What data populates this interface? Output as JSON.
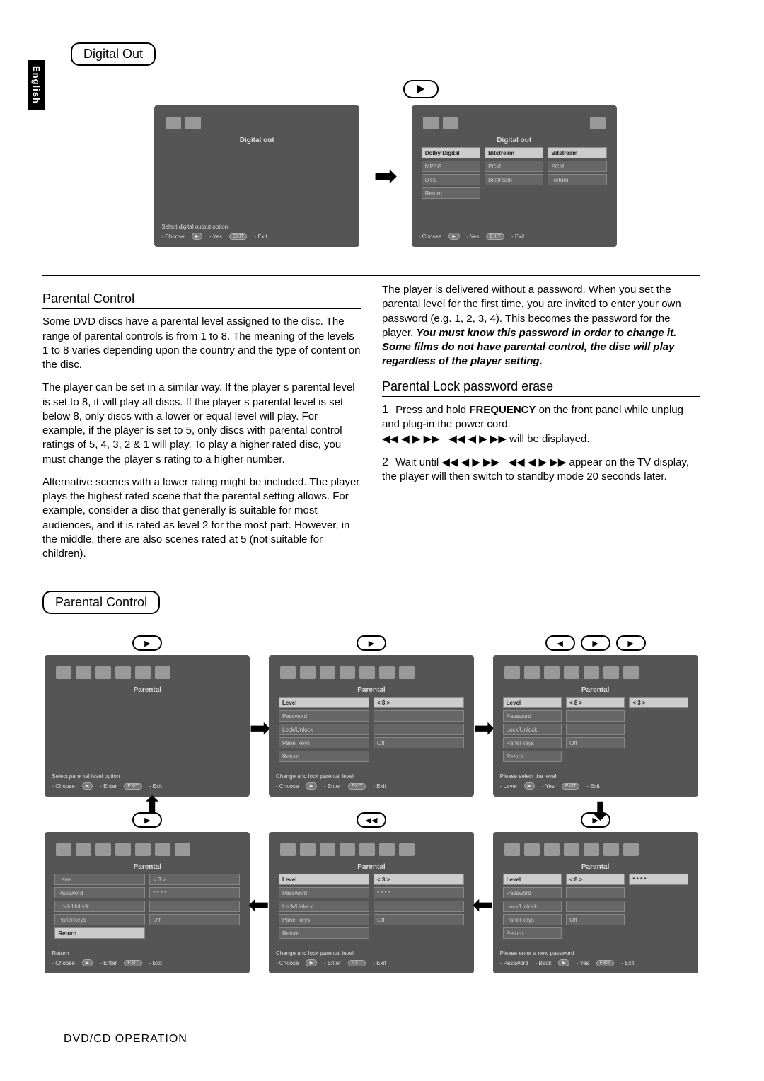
{
  "lang_tab": "English",
  "digital_out": {
    "label": "Digital Out",
    "screen1": {
      "title": "Digital out",
      "bottom": "Select digital output option",
      "hints": {
        "choose": "- Choose",
        "yes": "- Yes",
        "exit": "- Exit"
      }
    },
    "screen2": {
      "title": "Digital out",
      "col1": [
        "Dolby Digital",
        "MPEG",
        "DTS",
        "Return"
      ],
      "col2": [
        "Bitstream",
        "PCM",
        "Bitstream",
        ""
      ],
      "col3": [
        "Bitstream",
        "PCM",
        "Return"
      ],
      "hints": {
        "choose": "- Choose",
        "yes": "- Yes",
        "exit": "- Exit"
      }
    }
  },
  "parental_heading": "Parental Control",
  "para1": "Some DVD discs have a parental level assigned to the disc. The range of parental controls is from 1 to 8. The meaning of the levels 1 to 8 varies depending upon the country and the type of content on the disc.",
  "para2": "The player can be set in a similar way.  If the player s parental level is set to 8, it will play all discs.  If the player s parental level is set below 8, only discs with a lower or equal level will play.  For example, if the player is set to 5, only discs with parental control ratings of 5, 4, 3, 2 & 1 will play. To play a higher rated disc, you must change the player s rating to a higher number.",
  "para3": "Alternative scenes with a lower rating might be included. The player plays the highest rated scene that the parental setting allows.  For example, consider a disc that generally is suitable for most audiences, and it is rated as level 2 for the most part.  However, in the middle, there are also scenes rated at 5 (not suitable for children).",
  "para4a": "The player is delivered without a password.  When you set the parental level for the first time, you are invited to enter your own password (e.g. 1, 2, 3, 4).  This becomes the password for the player. ",
  "para4b": "You must know this password in order to change it.  Some films do not have parental control, the disc will play regardless of the player setting.",
  "lock_heading": "Parental Lock password erase",
  "step1a": "Press and hold ",
  "step1b": "FREQUENCY",
  "step1c": " on the front panel while unplug and plug-in the power cord.",
  "step1d": " will be displayed.",
  "step2a": "Wait until ",
  "step2b": " appear on the TV display, the player will then switch to standby mode 20 seconds later.",
  "step_num1": "1",
  "step_num2": "2",
  "parental_block_label": "Parental Control",
  "osd": {
    "p1": {
      "title": "Parental",
      "bottom": "Select parental level option",
      "hints": {
        "a": "- Choose",
        "b": "- Enter",
        "c": "- Exit"
      }
    },
    "p2": {
      "title": "Parental",
      "rows": [
        [
          "Level",
          "< 8 >"
        ],
        [
          "Password",
          ""
        ],
        [
          "Lock/Unlock",
          ""
        ],
        [
          "Panel keys",
          "Off"
        ],
        [
          "Return",
          ""
        ]
      ],
      "bottom": "Change and lock parental level",
      "hints": {
        "a": "- Choose",
        "b": "- Enter",
        "c": "- Exit"
      }
    },
    "p3": {
      "title": "Parental",
      "rows": [
        [
          "Level",
          "< 8 >"
        ],
        [
          "Password",
          ""
        ],
        [
          "Lock/Unlock",
          ""
        ],
        [
          "Panel keys",
          "Off"
        ],
        [
          "Return",
          ""
        ]
      ],
      "extra": "< 3 >",
      "bottom": "Please select the level",
      "hints": {
        "a": "- Level",
        "b": "- Yes",
        "c": "- Exit"
      }
    },
    "p4": {
      "title": "Parental",
      "rows": [
        [
          "Level",
          "< 8 >"
        ],
        [
          "Password",
          ""
        ],
        [
          "Lock/Unlock",
          ""
        ],
        [
          "Panel keys",
          "Off"
        ],
        [
          "Return",
          ""
        ]
      ],
      "extra": "* * * *",
      "bottom": "Please enter a new password",
      "hints": {
        "a": "- Password",
        "b": "- Back",
        "c": "- Yes",
        "d": "- Exit"
      }
    },
    "p5": {
      "title": "Parental",
      "rows": [
        [
          "Level",
          "< 3 >"
        ],
        [
          "Password",
          "* * * *"
        ],
        [
          "Lock/Unlock",
          ""
        ],
        [
          "Panel keys",
          "Off"
        ],
        [
          "Return",
          ""
        ]
      ],
      "bottom": "Change and lock parental level",
      "hints": {
        "a": "- Choose",
        "b": "- Enter",
        "c": "- Exit"
      }
    },
    "p6": {
      "title": "Parental",
      "rows": [
        [
          "Level",
          "< 3 >"
        ],
        [
          "Password",
          "* * * *"
        ],
        [
          "Lock/Unlock",
          ""
        ],
        [
          "Panel keys",
          "Off"
        ],
        [
          "Return",
          ""
        ]
      ],
      "bottom": "Return",
      "hints": {
        "a": "- Choose",
        "b": "- Enter",
        "c": "- Exit"
      }
    }
  },
  "footer": "DVD/CD OPERATION",
  "exit_label": "EXIT",
  "rew_label": "◀◀"
}
